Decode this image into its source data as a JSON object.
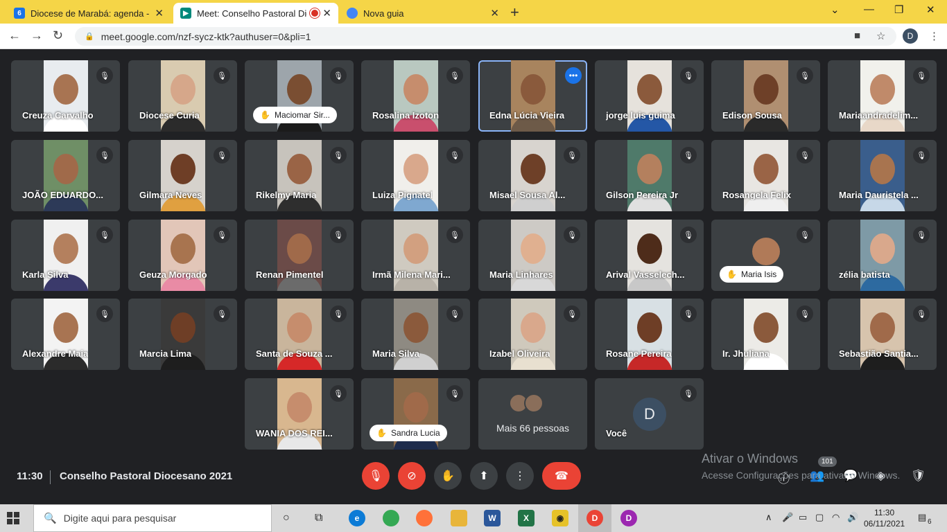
{
  "browser": {
    "tabs": [
      {
        "title": "Diocese de Marabá: agenda - De",
        "favicon": "6",
        "color": "#1a73e8"
      },
      {
        "title": "Meet: Conselho Pastoral Dio",
        "favicon": "meet",
        "color": "#00897b"
      },
      {
        "title": "Nova guia",
        "favicon": "chrome",
        "color": "#4285f4"
      }
    ],
    "url": "meet.google.com/nzf-sycz-ktk?authuser=0&pli=1",
    "profile_initial": "D"
  },
  "participants": [
    {
      "name": "Creuza Carvalho",
      "bg": "#e8ecef",
      "shirt": "#ffffff",
      "skin": "#a87452"
    },
    {
      "name": "Diocese Curia",
      "bg": "#d9cbb0",
      "shirt": "#2b2b2b",
      "skin": "#d6a78a"
    },
    {
      "name": "Maciomar Sir...",
      "bg": "#9da5ab",
      "shirt": "#1b1b1b",
      "skin": "#7a4e32",
      "hand": true
    },
    {
      "name": "Rosalina Izoton",
      "bg": "#b9c8c0",
      "shirt": "#c94f6d",
      "skin": "#c68d6d"
    },
    {
      "name": "Edna Lúcia Vieira",
      "bg": "#a8845e",
      "shirt": "#6d5a48",
      "skin": "#8a5a3c",
      "selected": true
    },
    {
      "name": "jorge luis guima",
      "bg": "#e6e2dc",
      "shirt": "#2457a6",
      "skin": "#8b5a3c"
    },
    {
      "name": "Edison Sousa",
      "bg": "#b08f71",
      "shirt": "#2a2a2a",
      "skin": "#6e4028"
    },
    {
      "name": "Mariaandradelim...",
      "bg": "#f1f1ec",
      "shirt": "#e8d8c8",
      "skin": "#c08a6a"
    },
    {
      "name": "JOÃO EDUARDO...",
      "bg": "#6f8f66",
      "shirt": "#2d3a58",
      "skin": "#a06a4a"
    },
    {
      "name": "Gilmara Neves",
      "bg": "#d6d2cc",
      "shirt": "#e0a040",
      "skin": "#6e3e26"
    },
    {
      "name": "Rikelmy Maria",
      "bg": "#c7c3bc",
      "shirt": "#2e2e2e",
      "skin": "#9a6446"
    },
    {
      "name": "Luiza Pignatel",
      "bg": "#f0efeb",
      "shirt": "#7fa8d0",
      "skin": "#d9a88c"
    },
    {
      "name": "Misael Sousa Al...",
      "bg": "#d8d4cf",
      "shirt": "#cfcfcf",
      "skin": "#6e4028"
    },
    {
      "name": "Gilson Pereira Jr",
      "bg": "#4f7a6a",
      "shirt": "#e0e0e0",
      "skin": "#b4805e"
    },
    {
      "name": "Rosangela Felix",
      "bg": "#e8e6e2",
      "shirt": "#efefef",
      "skin": "#9a6446"
    },
    {
      "name": "Maria Dauristela ...",
      "bg": "#3a5e8c",
      "shirt": "#c7d8e8",
      "skin": "#a8744f"
    },
    {
      "name": "Karla Silva",
      "bg": "#f0f0f0",
      "shirt": "#3b3a6b",
      "skin": "#b4805e"
    },
    {
      "name": "Geuza Morgado",
      "bg": "#e2c6b8",
      "shirt": "#e98ba5",
      "skin": "#a8744f"
    },
    {
      "name": "Renan Pimentel",
      "bg": "#6b4b48",
      "shirt": "#6b6b6b",
      "skin": "#a06a4a"
    },
    {
      "name": "Irmã Milena Mari...",
      "bg": "#cfcac0",
      "shirt": "#b8b2a8",
      "skin": "#d2a080"
    },
    {
      "name": "Maria Linhares",
      "bg": "#cdcac5",
      "shirt": "#d8d8d8",
      "skin": "#e0b090"
    },
    {
      "name": "Arival Vasselech...",
      "bg": "#e5e3df",
      "shirt": "#c8c8c8",
      "skin": "#4e2c1a"
    },
    {
      "name": "Maria Isis",
      "bg": "#3c4043",
      "shirt": "#3c4043",
      "skin": "#b07a58",
      "hand": true,
      "small": true
    },
    {
      "name": "zélia batista",
      "bg": "#7e9aa6",
      "shirt": "#2d6aa0",
      "skin": "#d9a88c"
    },
    {
      "name": "Alexandre Maia",
      "bg": "#f3f3f3",
      "shirt": "#2b2b2b",
      "skin": "#a87452"
    },
    {
      "name": "Marcia Lima",
      "bg": "#3a3a3a",
      "shirt": "#1e1e1e",
      "skin": "#6e3e26"
    },
    {
      "name": "Santa de Souza ...",
      "bg": "#c9b59c",
      "shirt": "#d62828",
      "skin": "#c68d6d"
    },
    {
      "name": "Maria Silva",
      "bg": "#8e8a82",
      "shirt": "#d0d0d0",
      "skin": "#8b5a3c"
    },
    {
      "name": "Izabel Oliveira",
      "bg": "#cfc9bc",
      "shirt": "#e8e0d0",
      "skin": "#d9a88c"
    },
    {
      "name": "Rosane Pereira",
      "bg": "#d8e0e4",
      "shirt": "#c62828",
      "skin": "#6e3e26"
    },
    {
      "name": "Ir. Jhuliana",
      "bg": "#ecebe7",
      "shirt": "#ffffff",
      "skin": "#8b5a3c"
    },
    {
      "name": "Sebastião Santia...",
      "bg": "#d7c4ad",
      "shirt": "#1e1e1e",
      "skin": "#a06a4a"
    },
    {
      "name": "WANIA DOS REI...",
      "bg": "#d8b78f",
      "shirt": "#e8e8e8",
      "skin": "#c68d6d"
    },
    {
      "name": "Sandra Lucia",
      "bg": "#8a6a4a",
      "shirt": "#1e2c4c",
      "skin": "#a06a4a",
      "hand": true,
      "nomic": true
    }
  ],
  "more_tile": {
    "label": "Mais 66 pessoas"
  },
  "self_tile": {
    "label": "Você",
    "initial": "D"
  },
  "meeting": {
    "time": "11:30",
    "title": "Conselho Pastoral Diocesano 2021",
    "participant_count": "101"
  },
  "watermark": {
    "line1": "Ativar o Windows",
    "line2": "Acesse Configurações para ativar o Windows."
  },
  "taskbar": {
    "search_placeholder": "Digite aqui para pesquisar",
    "time": "11:30",
    "date": "06/11/2021",
    "notif_count": "6"
  }
}
